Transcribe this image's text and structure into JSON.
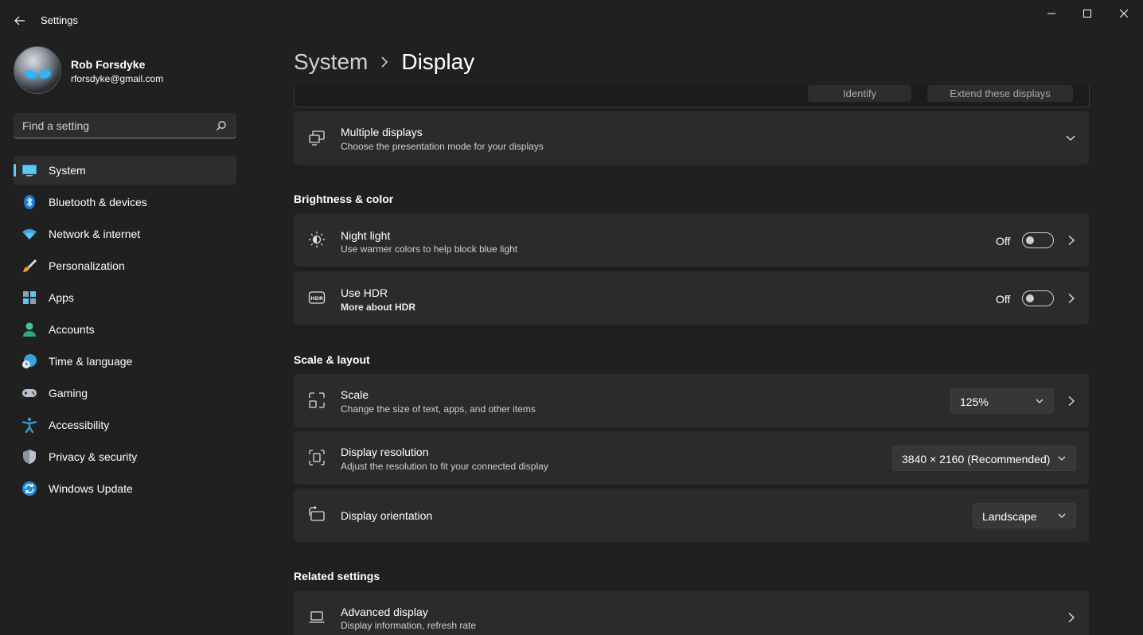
{
  "window": {
    "title": "Settings"
  },
  "profile": {
    "name": "Rob Forsdyke",
    "email": "rforsdyke@gmail.com"
  },
  "search": {
    "placeholder": "Find a setting"
  },
  "sidebar": {
    "items": [
      {
        "label": "System",
        "icon": "system-icon",
        "active": true
      },
      {
        "label": "Bluetooth & devices",
        "icon": "bluetooth-icon"
      },
      {
        "label": "Network & internet",
        "icon": "wifi-icon"
      },
      {
        "label": "Personalization",
        "icon": "brush-icon"
      },
      {
        "label": "Apps",
        "icon": "apps-icon"
      },
      {
        "label": "Accounts",
        "icon": "person-icon"
      },
      {
        "label": "Time & language",
        "icon": "globe-clock-icon"
      },
      {
        "label": "Gaming",
        "icon": "gamepad-icon"
      },
      {
        "label": "Accessibility",
        "icon": "accessibility-icon"
      },
      {
        "label": "Privacy & security",
        "icon": "shield-icon"
      },
      {
        "label": "Windows Update",
        "icon": "update-icon"
      }
    ]
  },
  "breadcrumb": {
    "parent": "System",
    "current": "Display"
  },
  "top_buttons": {
    "identify": "Identify",
    "extend": "Extend these displays"
  },
  "multiple_displays": {
    "title": "Multiple displays",
    "subtitle": "Choose the presentation mode for your displays"
  },
  "brightness_section": {
    "title": "Brightness & color",
    "night_light": {
      "title": "Night light",
      "subtitle": "Use warmer colors to help block blue light",
      "state": "Off"
    },
    "hdr": {
      "title": "Use HDR",
      "subtitle": "More about HDR",
      "state": "Off"
    }
  },
  "scale_section": {
    "title": "Scale & layout",
    "scale": {
      "title": "Scale",
      "subtitle": "Change the size of text, apps, and other items",
      "value": "125%"
    },
    "resolution": {
      "title": "Display resolution",
      "subtitle": "Adjust the resolution to fit your connected display",
      "value": "3840 × 2160 (Recommended)"
    },
    "orientation": {
      "title": "Display orientation",
      "value": "Landscape"
    }
  },
  "related_section": {
    "title": "Related settings",
    "advanced": {
      "title": "Advanced display",
      "subtitle": "Display information, refresh rate"
    }
  },
  "colors": {
    "accent": "#60cdff",
    "background": "#202020",
    "card": "#2b2b2b"
  }
}
